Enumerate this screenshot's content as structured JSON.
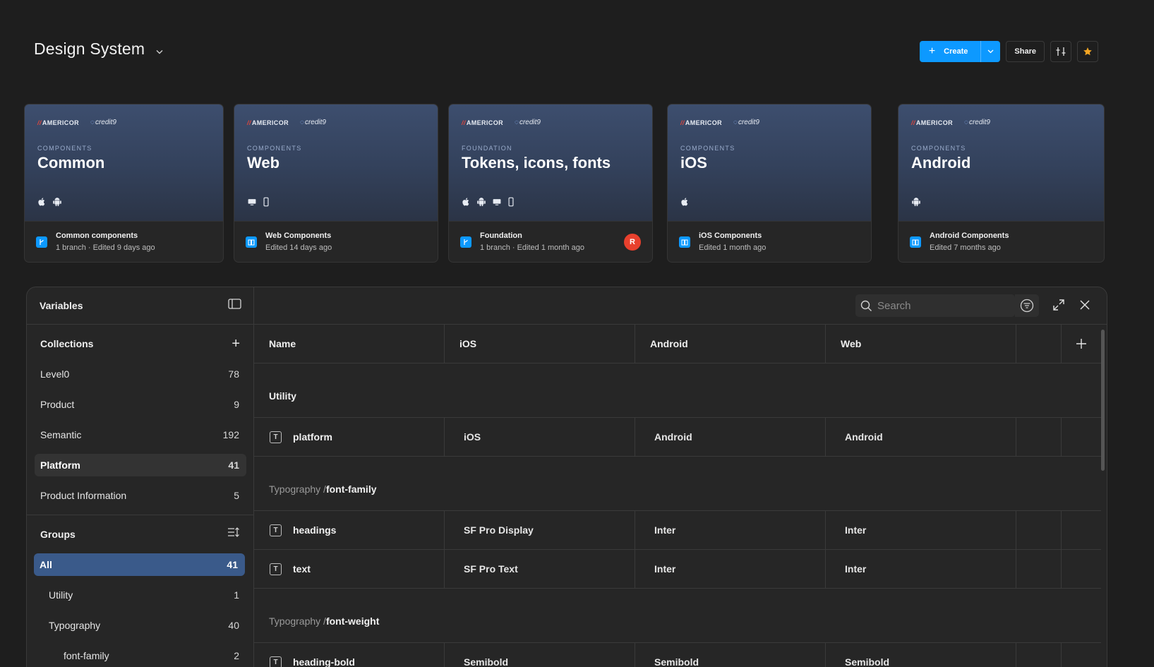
{
  "header": {
    "title": "Design System"
  },
  "actions": {
    "create_label": "Create",
    "share_label": "Share"
  },
  "cards": [
    {
      "kind": "COMPONENTS",
      "name": "Common",
      "logo_a": "AMERICOR",
      "logo_b": "credit9",
      "file_name": "Common components",
      "file_sub": "1 branch · Edited 9 days ago",
      "platforms": [
        "apple",
        "android"
      ],
      "file_icon": "branch"
    },
    {
      "kind": "COMPONENTS",
      "name": "Web",
      "logo_a": "AMERICOR",
      "logo_b": "credit9",
      "file_name": "Web Components",
      "file_sub": "Edited 14 days ago",
      "platforms": [
        "desktop",
        "mobile"
      ],
      "file_icon": "library"
    },
    {
      "kind": "FOUNDATION",
      "name": "Tokens, icons, fonts",
      "logo_a": "AMERICOR",
      "logo_b": "credit9",
      "file_name": "Foundation",
      "file_sub": "1 branch · Edited 1 month ago",
      "platforms": [
        "apple",
        "android",
        "desktop",
        "mobile"
      ],
      "file_icon": "branch",
      "avatar": "R"
    },
    {
      "kind": "COMPONENTS",
      "name": "iOS",
      "logo_a": "AMERICOR",
      "logo_b": "credit9",
      "file_name": "iOS Components",
      "file_sub": "Edited 1 month ago",
      "platforms": [
        "apple"
      ],
      "file_icon": "library"
    },
    {
      "kind": "COMPONENTS",
      "name": "Android",
      "logo_a": "AMERICOR",
      "logo_b": "credit9",
      "file_name": "Android Components",
      "file_sub": "Edited 7 months ago",
      "platforms": [
        "android"
      ],
      "file_icon": "library"
    }
  ],
  "variables": {
    "title": "Variables",
    "collections_label": "Collections",
    "collections": [
      {
        "name": "Level0",
        "count": "78"
      },
      {
        "name": "Product",
        "count": "9"
      },
      {
        "name": "Semantic",
        "count": "192"
      },
      {
        "name": "Platform",
        "count": "41",
        "selected": true
      },
      {
        "name": "Product Information",
        "count": "5"
      }
    ],
    "groups_label": "Groups",
    "groups": [
      {
        "name": "All",
        "count": "41",
        "selected": true,
        "level": 0
      },
      {
        "name": "Utility",
        "count": "1",
        "level": 1
      },
      {
        "name": "Typography",
        "count": "40",
        "level": 1
      },
      {
        "name": "font-family",
        "count": "2",
        "level": 2
      }
    ],
    "search_placeholder": "Search",
    "columns": [
      "Name",
      "iOS",
      "Android",
      "Web"
    ],
    "sections": [
      {
        "prefix": "",
        "group": "Utility",
        "rows": [
          {
            "name": "platform",
            "ios": "iOS",
            "android": "Android",
            "web": "Android"
          }
        ]
      },
      {
        "prefix": "Typography / ",
        "group": "font-family",
        "rows": [
          {
            "name": "headings",
            "ios": "SF Pro Display",
            "android": "Inter",
            "web": "Inter"
          },
          {
            "name": "text",
            "ios": "SF Pro Text",
            "android": "Inter",
            "web": "Inter"
          }
        ]
      },
      {
        "prefix": "Typography / ",
        "group": "font-weight",
        "rows": [
          {
            "name": "heading-bold",
            "ios": "Semibold",
            "android": "Semibold",
            "web": "Semibold"
          }
        ]
      }
    ]
  },
  "colors": {
    "accent": "#0d99ff",
    "avatar": "#e8402d",
    "selected_group": "#3a5a8a",
    "star": "#f5a623"
  }
}
